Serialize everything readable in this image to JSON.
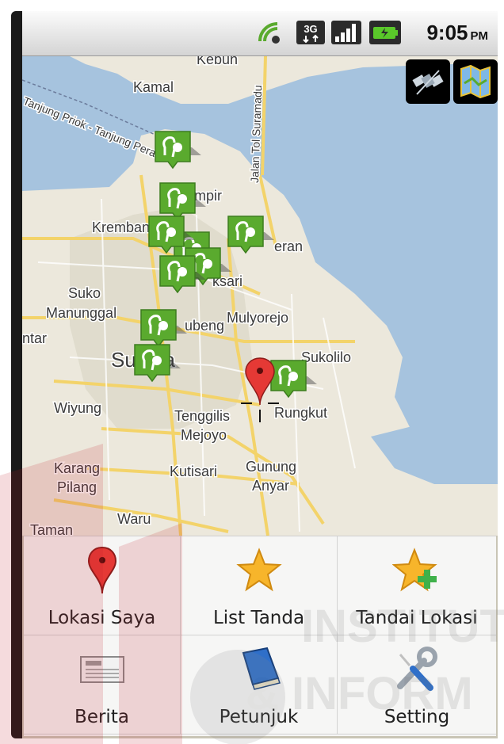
{
  "status_bar": {
    "network": "3G",
    "time": "9:05",
    "ampm": "PM",
    "icons": [
      "signal-bars-icon",
      "3g-icon",
      "sync-icon",
      "battery-icon"
    ]
  },
  "map": {
    "labels": {
      "kamal": "Kamal",
      "kebun": "Kebun",
      "tanjung": "Tanjung Priok - Tanjung Perak",
      "suramadu": "Jalan Tol Suramadu",
      "krembang": "Kremban",
      "sukomanunggal_1": "Suko",
      "sukomanunggal_2": "Manunggal",
      "mulyorejo": "Mulyorejo",
      "surabaya": "Su  aya",
      "sukolilo": "Sukolilo",
      "wiyung": "Wiyung",
      "tenggilis_1": "Tenggilis",
      "tenggilis_2": "Mejoyo",
      "rungkut": "Rungkut",
      "karang_1": "Karang",
      "karang_2": "Pilang",
      "kutisari": "Kutisari",
      "gunung_1": "Gunung",
      "gunung_2": "Anyar",
      "waru": "Waru",
      "taman": "Taman",
      "ntar": "ntar",
      "sampir": "S  mpir",
      "eran": "eran",
      "ksari": "ksari",
      "ubeng": "ubeng"
    },
    "buttons": [
      "satellite-view-button",
      "map-view-button"
    ]
  },
  "menu": {
    "items": [
      {
        "label": "Lokasi Saya",
        "icon": "map-pin-icon"
      },
      {
        "label": "List Tanda",
        "icon": "star-icon"
      },
      {
        "label": "Tandai Lokasi",
        "icon": "star-plus-icon"
      },
      {
        "label": "Berita",
        "icon": "newspaper-icon"
      },
      {
        "label": "Petunjuk",
        "icon": "book-icon"
      },
      {
        "label": "Setting",
        "icon": "wrench-screwdriver-icon"
      }
    ]
  },
  "colors": {
    "sea": "#a6c3de",
    "land": "#ece8dc",
    "marker_green": "#5aaa2e",
    "pin_red": "#e53935",
    "star_yellow": "#f7b52b"
  },
  "watermark": {
    "line1": "INSTITUT",
    "line2": "& INFORM"
  }
}
